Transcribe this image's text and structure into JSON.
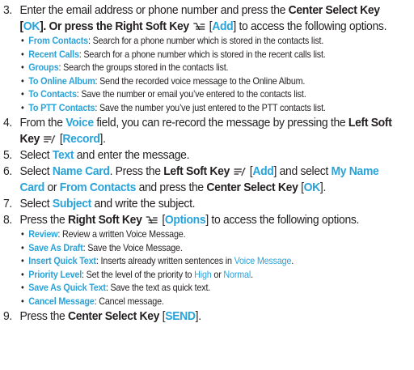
{
  "step3": {
    "num": "3.",
    "l1a": "Enter the email address or phone number and press the ",
    "k1": "Center Select Key",
    "l2a": "[",
    "b1": "OK",
    "l2b": "]. Or press the ",
    "k2": "Right Soft Key",
    "l2c": " [",
    "b2": "Add",
    "l2d": "] to access the following options.",
    "items": [
      {
        "term": "From Contacts",
        "desc": ": Search for a phone number which is stored in the contacts list."
      },
      {
        "term": "Recent Calls",
        "desc": ": Search for a phone number which is stored in the recent calls list."
      },
      {
        "term": "Groups",
        "desc": ": Search the groups stored in the contacts list."
      },
      {
        "term": "To Online Album",
        "desc": ": Send the recorded voice message to the Online Album."
      },
      {
        "term": "To Contacts",
        "desc": ": Save the number or email you’ve entered to the contacts list."
      },
      {
        "term": "To PTT Contacts",
        "desc": ": Save the number you’ve just entered to the PTT contacts list."
      }
    ]
  },
  "step4": {
    "num": "4.",
    "a": "From the ",
    "b1": "Voice",
    "c": " field, you can re-record the message by pressing the ",
    "k1": "Left Soft",
    "k2": "Key",
    "d": " [",
    "b2": "Record",
    "e": "]."
  },
  "step5": {
    "num": "5.",
    "a": "Select ",
    "b1": "Text",
    "c": " and enter the message."
  },
  "step6": {
    "num": "6.",
    "a": "Select ",
    "b1": "Name Card",
    "c": ". Press the ",
    "k1": "Left Soft Key",
    "d": " [",
    "b2": "Add",
    "e": "] and select ",
    "b3": "My Name",
    "b4": "Card",
    "f": " or ",
    "b5": "From Contacts",
    "g": " and press the ",
    "k2": "Center Select Key",
    "h": " [",
    "b6": "OK",
    "i": "]."
  },
  "step7": {
    "num": "7.",
    "a": "Select ",
    "b1": "Subject",
    "c": " and write the subject."
  },
  "step8": {
    "num": "8.",
    "a": "Press the ",
    "k1": "Right Soft Key",
    "d": " [",
    "b1": "Options",
    "e": "] to access the following options.",
    "items": [
      {
        "term": "Review",
        "desc": ": Review a written Voice Message."
      },
      {
        "term": "Save As Draft",
        "desc": ": Save the Voice Message."
      },
      {
        "term": "Insert Quick Text",
        "desc": ": Inserts already written sentences in ",
        "hl": "Voice Message",
        "tail": "."
      },
      {
        "term": "Priority Level",
        "desc": ": Set the level of the priority to ",
        "hl": "High",
        "mid": " or ",
        "hl2": "Normal",
        "tail": "."
      },
      {
        "term": "Save As Quick Text",
        "desc": ": Save the text as quick text."
      },
      {
        "term": "Cancel Message",
        "desc": ": Cancel message."
      }
    ]
  },
  "step9": {
    "num": "9.",
    "a": "Press the ",
    "k1": "Center Select Key",
    "d": " [",
    "b1": "SEND",
    "e": "]."
  },
  "icons": {
    "right_soft_key": "right-soft-key-icon",
    "left_soft_key": "left-soft-key-icon"
  },
  "colors": {
    "highlight": "#29a3d9",
    "text": "#231f20"
  }
}
